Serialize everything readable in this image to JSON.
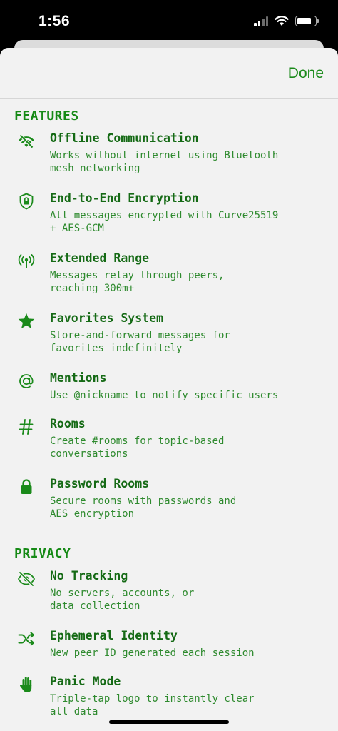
{
  "status_bar": {
    "time": "1:56"
  },
  "nav": {
    "done_label": "Done"
  },
  "sections": {
    "features": {
      "title": "FEATURES",
      "items": [
        {
          "icon": "wifi-off-icon",
          "title": "Offline Communication",
          "desc": "Works without internet using Bluetooth\nmesh networking"
        },
        {
          "icon": "lock-shield-icon",
          "title": "End-to-End Encryption",
          "desc": "All messages encrypted with Curve25519\n+ AES-GCM"
        },
        {
          "icon": "antenna-icon",
          "title": "Extended Range",
          "desc": "Messages relay through peers,\nreaching 300m+"
        },
        {
          "icon": "star-icon",
          "title": "Favorites System",
          "desc": "Store-and-forward messages for\nfavorites indefinitely"
        },
        {
          "icon": "at-sign-icon",
          "title": "Mentions",
          "desc": "Use @nickname to notify specific users"
        },
        {
          "icon": "hash-icon",
          "title": "Rooms",
          "desc": "Create #rooms for topic-based\nconversations"
        },
        {
          "icon": "lock-icon",
          "title": "Password Rooms",
          "desc": "Secure rooms with passwords and\nAES encryption"
        }
      ]
    },
    "privacy": {
      "title": "PRIVACY",
      "items": [
        {
          "icon": "eye-slash-icon",
          "title": "No Tracking",
          "desc": "No servers, accounts, or\ndata collection"
        },
        {
          "icon": "shuffle-icon",
          "title": "Ephemeral Identity",
          "desc": "New peer ID generated each session"
        },
        {
          "icon": "hand-raised-icon",
          "title": "Panic Mode",
          "desc": "Triple-tap logo to instantly clear\nall data"
        }
      ]
    }
  },
  "colors": {
    "accent": "#1a8a1a",
    "title": "#156a15",
    "description": "#2e8a2e",
    "background": "#f2f2f2"
  }
}
